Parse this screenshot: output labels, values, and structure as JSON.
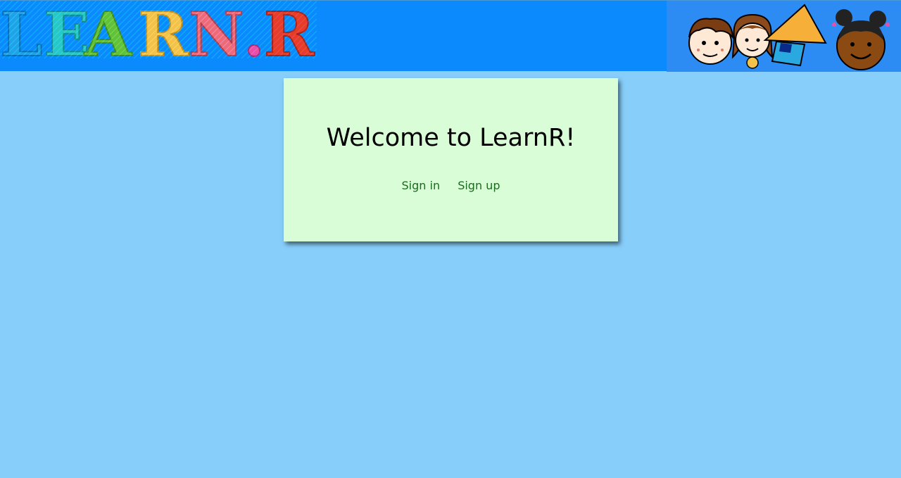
{
  "header": {
    "logo_text": "LEARN.R",
    "logo_letter_colors": [
      "#1fa2e8",
      "#27c7c7",
      "#5fc23a",
      "#f3c24b",
      "#ec6a7a",
      "#e84fa6",
      "#e63c2c"
    ],
    "background_color": "#0b8afd",
    "kids_image": "kids-faces-illustration"
  },
  "main": {
    "background_color": "#87cefa",
    "card": {
      "title": "Welcome to LearnR!",
      "background_color": "#d9fed7",
      "links": [
        {
          "label": "Sign in"
        },
        {
          "label": "Sign up"
        }
      ],
      "link_color": "#1a6b1e"
    }
  }
}
